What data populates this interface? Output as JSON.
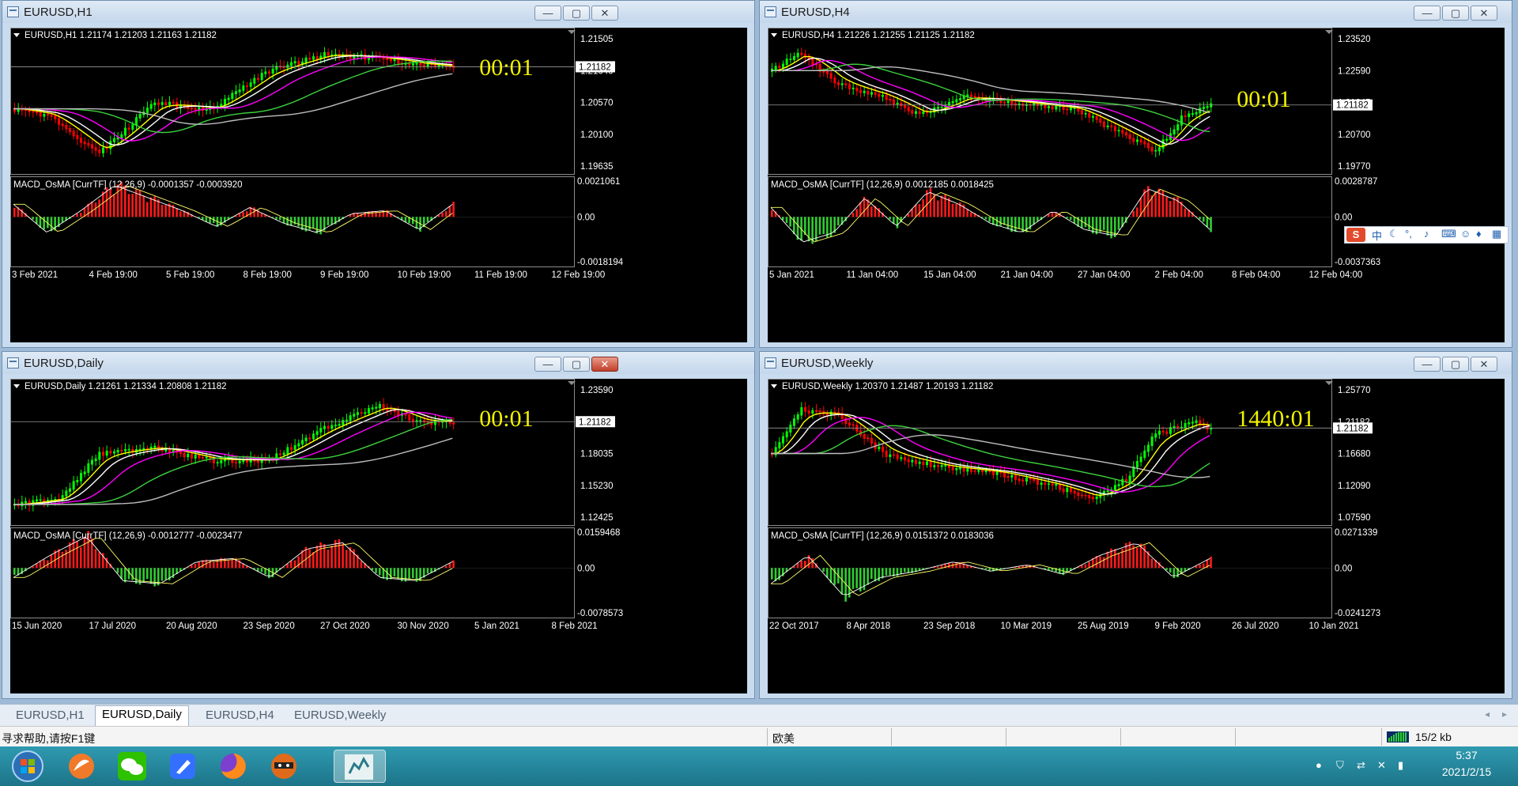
{
  "colors": {
    "bull": "#00ff00",
    "bear": "#ff0000",
    "ma_yellow": "#ffff00",
    "ma_white": "#ffffff",
    "ma_magenta": "#ff00ff",
    "ma_green": "#3cd23c",
    "ma_gray": "#bdbdbd",
    "hist_pos": "#ff1a1a",
    "hist_neg": "#33cc33",
    "timer": "#f2f200"
  },
  "windows": [
    {
      "key": "h1",
      "title": "EURUSD,H1",
      "header": "EURUSD,H1  1.21174 1.21203 1.21163 1.21182",
      "price_labels": [
        "1.21505",
        "1.21040",
        "1.20570",
        "1.20100",
        "1.19635"
      ],
      "current_price": "1.21182",
      "timer": "00:01",
      "macd_label": "MACD_OsMA [CurrTF] (12,26,9) -0.0001357 -0.0003920",
      "macd_labels": [
        "0.0021061",
        "0.00",
        "-0.0018194"
      ],
      "time_labels": [
        "3 Feb 2021",
        "4 Feb 19:00",
        "5 Feb 19:00",
        "8 Feb 19:00",
        "9 Feb 19:00",
        "10 Feb 19:00",
        "11 Feb 19:00",
        "12 Feb 19:00"
      ],
      "close_active": false
    },
    {
      "key": "h4",
      "title": "EURUSD,H4",
      "header": "EURUSD,H4  1.21226 1.21255 1.21125 1.21182",
      "price_labels": [
        "1.23520",
        "1.22590",
        "1.21645",
        "1.20700",
        "1.19770"
      ],
      "current_price": "1.21182",
      "timer": "00:01",
      "macd_label": "MACD_OsMA [CurrTF] (12,26,9) 0.0012185 0.0018425",
      "macd_labels": [
        "0.0028787",
        "0.00",
        "-0.0037363"
      ],
      "time_labels": [
        "5 Jan 2021",
        "11 Jan 04:00",
        "15 Jan 04:00",
        "21 Jan 04:00",
        "27 Jan 04:00",
        "2 Feb 04:00",
        "8 Feb 04:00",
        "12 Feb 04:00"
      ],
      "close_active": false
    },
    {
      "key": "d1",
      "title": "EURUSD,Daily",
      "header": "EURUSD,Daily  1.21261 1.21334 1.20808 1.21182",
      "price_labels": [
        "1.23590",
        "1.20785",
        "1.18035",
        "1.15230",
        "1.12425"
      ],
      "current_price": "1.21182",
      "timer": "00:01",
      "macd_label": "MACD_OsMA [CurrTF] (12,26,9) -0.0012777 -0.0023477",
      "macd_labels": [
        "0.0159468",
        "0.00",
        "-0.0078573"
      ],
      "time_labels": [
        "15 Jun 2020",
        "17 Jul 2020",
        "20 Aug 2020",
        "23 Sep 2020",
        "27 Oct 2020",
        "30 Nov 2020",
        "5 Jan 2021",
        "8 Feb 2021"
      ],
      "close_active": true
    },
    {
      "key": "w1",
      "title": "EURUSD,Weekly",
      "header": "EURUSD,Weekly  1.20370 1.21487 1.20193 1.21182",
      "price_labels": [
        "1.25770",
        "1.21182",
        "1.16680",
        "1.12090",
        "1.07590"
      ],
      "current_price": "1.21182",
      "timer": "1440:01",
      "macd_label": "MACD_OsMA [CurrTF] (12,26,9) 0.0151372 0.0183036",
      "macd_labels": [
        "0.0271339",
        "0.00",
        "-0.0241273"
      ],
      "time_labels": [
        "22 Oct 2017",
        "8 Apr 2018",
        "23 Sep 2018",
        "10 Mar 2019",
        "25 Aug 2019",
        "9 Feb 2020",
        "26 Jul 2020",
        "10 Jan 2021"
      ],
      "close_active": false
    }
  ],
  "window_buttons": {
    "minimize": "—",
    "maximize": "▢",
    "close": "✕"
  },
  "tabs": [
    "EURUSD,H1",
    "EURUSD,Daily",
    "EURUSD,H4",
    "EURUSD,Weekly"
  ],
  "active_tab": "EURUSD,Daily",
  "status": {
    "help": "寻求帮助,请按F1键",
    "profile": "欧美",
    "traffic": "15/2 kb"
  },
  "ime": {
    "logo": "S",
    "lang": "中"
  },
  "taskbar": {
    "time": "5:37",
    "date": "2021/2/15",
    "apps": [
      "start-orb",
      "rocket-app",
      "wechat",
      "feishu-docs",
      "firefox",
      "ninja-app",
      "mt4-terminal"
    ]
  }
}
